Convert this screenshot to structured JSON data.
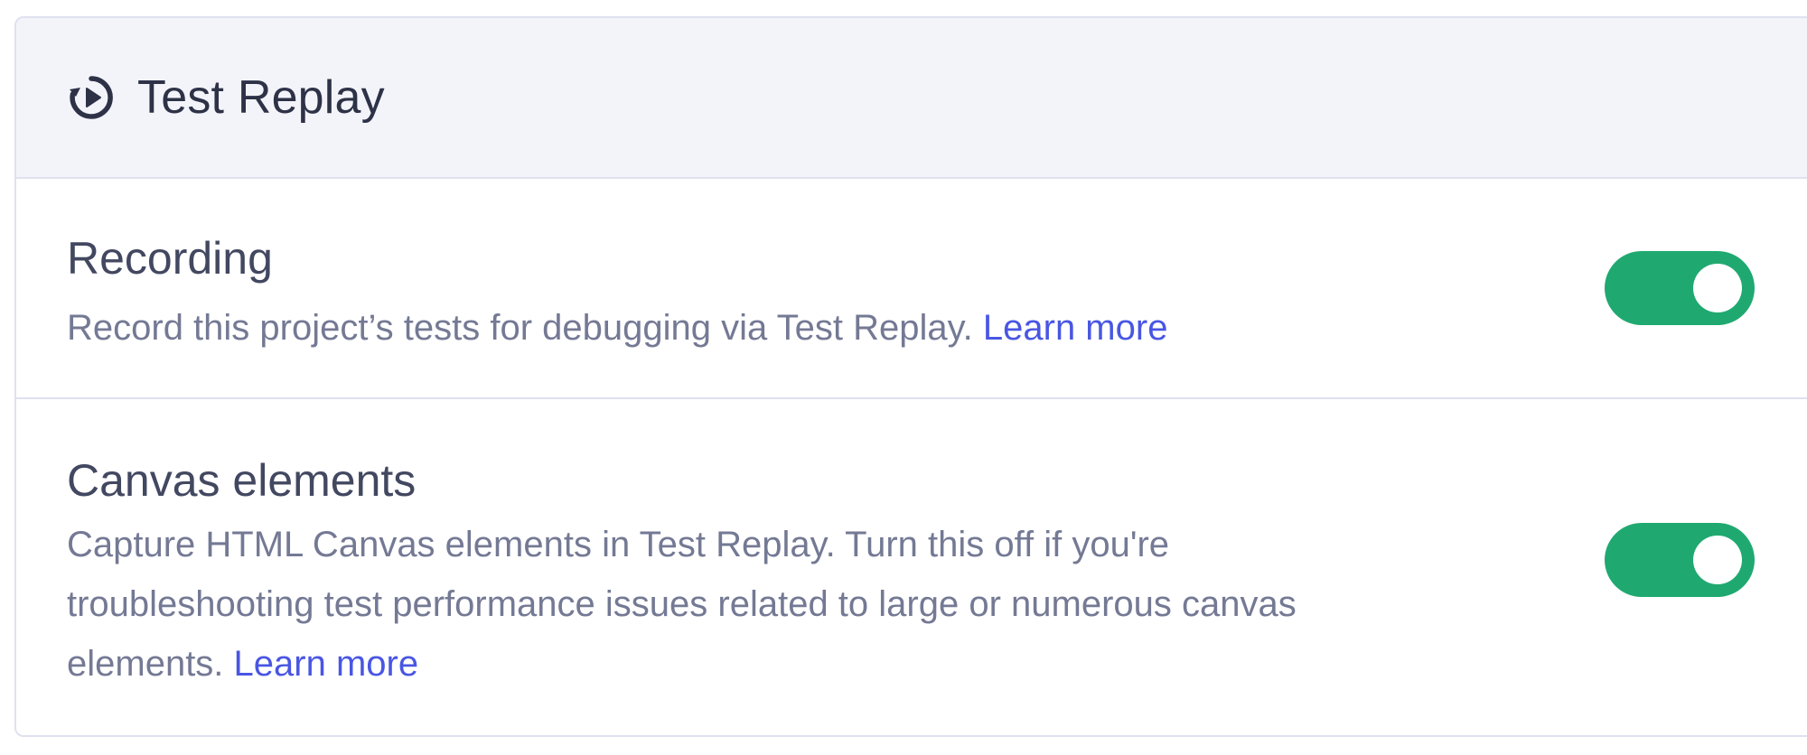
{
  "panel": {
    "title": "Test Replay",
    "icon": "replay-icon"
  },
  "settings": [
    {
      "title": "Recording",
      "description": "Record this project’s tests for debugging via Test Replay.",
      "link_label": "Learn more",
      "enabled": true
    },
    {
      "title": "Canvas elements",
      "description": "Capture HTML Canvas elements in Test Replay. Turn this off if you're troubleshooting test performance issues related to large or numerous canvas elements.",
      "link_label": "Learn more",
      "enabled": true
    }
  ],
  "colors": {
    "toggle_on": "#1fa971",
    "link": "#4956e3",
    "header_bg": "#f3f4fa"
  }
}
